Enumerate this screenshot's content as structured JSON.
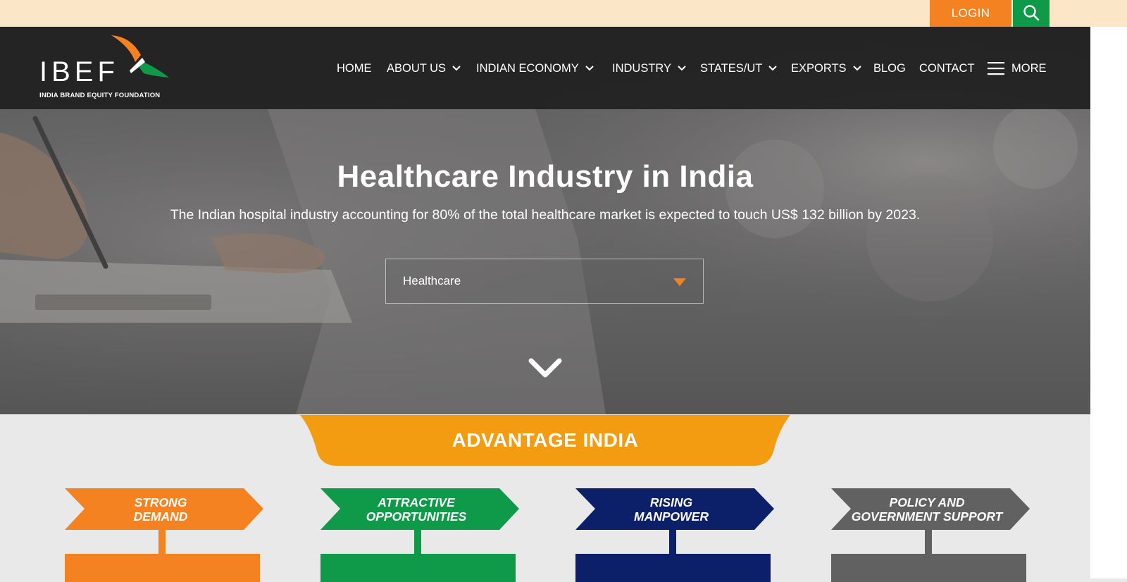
{
  "topbar": {
    "login_label": "LOGIN",
    "search_icon": "search-icon",
    "colors": {
      "background": "#fbe7c8",
      "login": "#f58220",
      "search": "#0e9a48"
    }
  },
  "logo": {
    "wordmark": "IBEF",
    "tagline": "INDIA BRAND EQUITY FOUNDATION"
  },
  "nav": {
    "items": [
      {
        "label": "HOME",
        "dropdown": false
      },
      {
        "label": "ABOUT US",
        "dropdown": true
      },
      {
        "label": "INDIAN ECONOMY",
        "dropdown": true
      },
      {
        "label": "INDUSTRY",
        "dropdown": true
      },
      {
        "label": "STATES/UT",
        "dropdown": true
      },
      {
        "label": "EXPORTS",
        "dropdown": true
      },
      {
        "label": "BLOG",
        "dropdown": false
      },
      {
        "label": "CONTACT",
        "dropdown": false
      }
    ],
    "more_label": "MORE",
    "more_icon": "hamburger-icon"
  },
  "hero": {
    "title": "Healthcare Industry in India",
    "subtitle": "The Indian hospital industry accounting for 80% of the total healthcare market is expected to touch US$ 132 billion by 2023.",
    "sector_select": {
      "value": "Healthcare",
      "caret_color": "#f58220"
    },
    "scroll_icon": "chevron-down-icon"
  },
  "advantage": {
    "title": "ADVANTAGE INDIA",
    "tab_color": "#f39c12",
    "cards": [
      {
        "line1": "STRONG",
        "line2": "DEMAND",
        "color": "#f58220"
      },
      {
        "line1": "ATTRACTIVE",
        "line2": "OPPORTUNITIES",
        "color": "#0e9a48"
      },
      {
        "line1": "RISING",
        "line2": "MANPOWER",
        "color": "#0b2068"
      },
      {
        "line1": "POLICY AND",
        "line2": "GOVERNMENT SUPPORT",
        "color": "#616161"
      }
    ]
  }
}
